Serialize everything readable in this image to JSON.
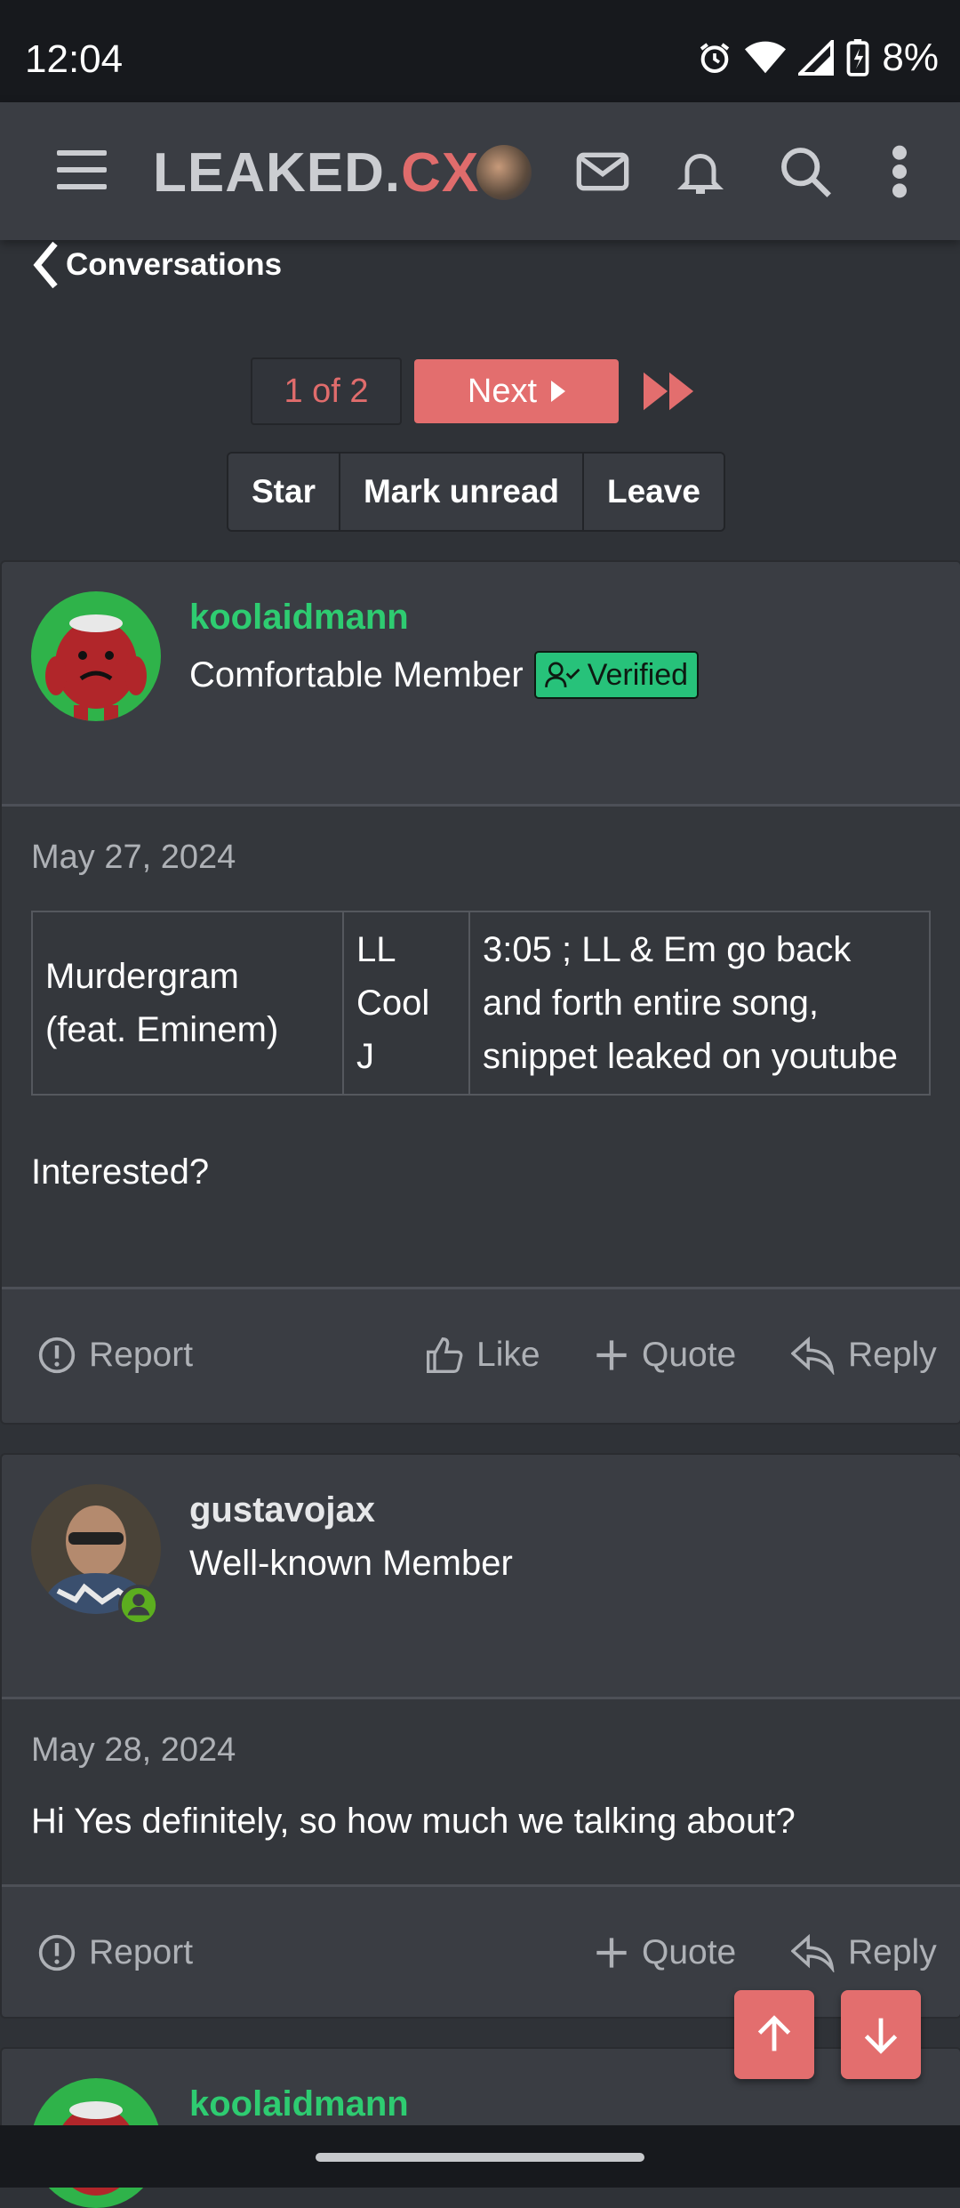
{
  "status": {
    "time": "12:04",
    "battery": "8%"
  },
  "app": {
    "logo_part1": "LEAKED.",
    "logo_part2": "CX"
  },
  "nav": {
    "back_label": "Conversations"
  },
  "pager": {
    "current": "1 of 2",
    "next_label": "Next"
  },
  "actions": {
    "star": "Star",
    "mark_unread": "Mark unread",
    "leave": "Leave"
  },
  "messages": [
    {
      "username": "koolaidmann",
      "user_title": "Comfortable Member",
      "badge": "Verified",
      "date": "May 27, 2024",
      "table": [
        [
          "Murdergram (feat. Eminem)",
          "LL Cool J",
          "3:05 ; LL & Em go back and forth entire song, snippet leaked on youtube"
        ]
      ],
      "text": "Interested?",
      "report": "Report",
      "like": "Like",
      "quote": "Quote",
      "reply": "Reply"
    },
    {
      "username": "gustavojax",
      "user_title": "Well-known Member",
      "date": "May 28, 2024",
      "text": "Hi Yes definitely, so how much we talking about?",
      "report": "Report",
      "quote": "Quote",
      "reply": "Reply"
    },
    {
      "username": "koolaidmann"
    }
  ],
  "colors": {
    "accent": "#e36e6e",
    "username_green": "#2ecc71",
    "verified_bg": "#27c27a"
  }
}
